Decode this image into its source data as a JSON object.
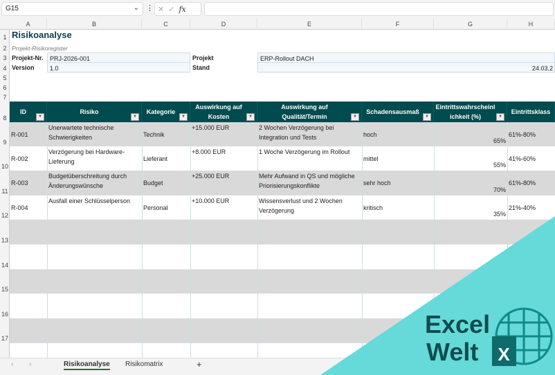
{
  "toolbar": {
    "name_box": "G15",
    "formula_value": "",
    "icons": [
      "chevron-down-icon",
      "more-icon",
      "cancel-icon",
      "confirm-icon",
      "fx-icon"
    ]
  },
  "columns": [
    "A",
    "B",
    "C",
    "D",
    "E",
    "F",
    "G",
    "H"
  ],
  "rows": [
    "1",
    "2",
    "3",
    "4",
    "5",
    "6",
    "7",
    "8",
    "9",
    "10",
    "11",
    "12",
    "13",
    "14",
    "15",
    "16",
    "17"
  ],
  "sheet": {
    "title": "Risikoanalyse",
    "subtitle": "Projekt-Risikoregister",
    "meta": {
      "projekt_nr_label": "Projekt-Nr.",
      "projekt_nr": "PRJ-2026-001",
      "version_label": "Version",
      "version": "1.0",
      "projekt_label": "Projekt",
      "projekt": "ERP-Rollout DACH",
      "stand_label": "Stand",
      "stand": "24.03.2"
    },
    "headers": [
      "ID",
      "Risiko",
      "Kategorie",
      "Auswirkung auf Kosten",
      "Auswirkung auf Qualität/Termin",
      "Schadensausmaß",
      "Eintrittswahrscheinlichkeit (%)",
      "Eintrittsklass"
    ],
    "data": [
      [
        "R-001",
        "Unerwartete technische Schwierigkeiten",
        "Technik",
        "+15.000 EUR",
        "2 Wochen Verzögerung bei Integration und Tests",
        "hoch",
        "65%",
        "61%-80%"
      ],
      [
        "R-002",
        "Verzögerung bei Hardware-Lieferung",
        "Lieferant",
        "+8.000 EUR",
        "1 Woche Verzögerung im Rollout",
        "mittel",
        "55%",
        "41%-60%"
      ],
      [
        "R-003",
        "Budgetüberschreitung durch Änderungswünsche",
        "Budget",
        "+25.000 EUR",
        "Mehr Aufwand in QS und mögliche Priorisierungskonflikte",
        "sehr hoch",
        "70%",
        "61%-80%"
      ],
      [
        "R-004",
        "Ausfall einer Schlüsselperson",
        "Personal",
        "+10.000 EUR",
        "Wissensverlust und 2 Wochen Verzögerung",
        "kritisch",
        "35%",
        "21%-40%"
      ]
    ]
  },
  "tabs": {
    "items": [
      "Risikoanalyse",
      "Risikomatrix"
    ],
    "active": "Risikoanalyse",
    "add": "+"
  },
  "logo": {
    "line1": "Excel",
    "line2": "Welt",
    "mark": "X"
  },
  "colors": {
    "header": "#004b4f",
    "band": "#d9d9d9",
    "logo_bg": "#66d9d9",
    "logo_text": "#0d4d50",
    "tab_underline": "#1e7145"
  }
}
